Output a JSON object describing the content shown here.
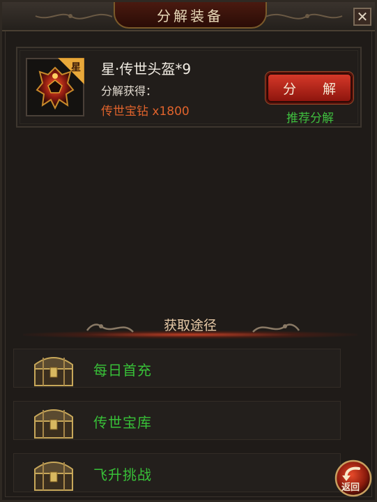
{
  "window": {
    "title": "分解装备",
    "close_label": "✕"
  },
  "item": {
    "badge": "星",
    "name": "星·传世头盔*9",
    "decompose_prefix": "分解获得：",
    "reward": "传世宝钻 x1800",
    "decompose_button": "分 解",
    "recommend_label": "推荐分解"
  },
  "sources": {
    "title": "获取途径",
    "items": [
      {
        "label": "每日首充",
        "icon": "treasure-chest-icon"
      },
      {
        "label": "传世宝库",
        "icon": "treasure-chest-icon"
      },
      {
        "label": "飞升挑战",
        "icon": "treasure-chest-icon"
      }
    ]
  },
  "footer": {
    "back_label": "返回"
  },
  "colors": {
    "panel_bg": "#1f1b18",
    "reward_orange": "#e0632c",
    "green_text": "#38c038",
    "button_red": "#d93a2a",
    "title_text": "#e8d9b8"
  }
}
